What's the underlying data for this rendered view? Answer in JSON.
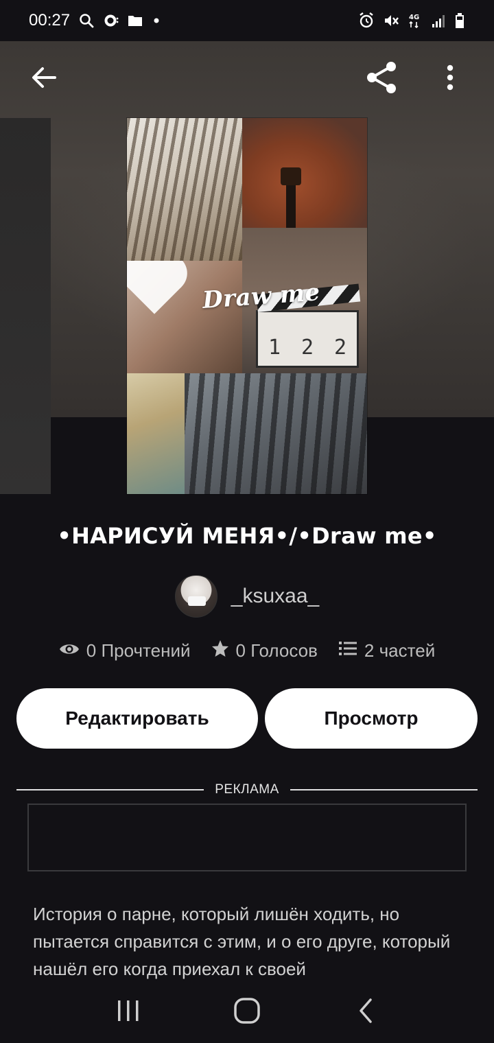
{
  "status_bar": {
    "time": "00:27",
    "network_label": "4G"
  },
  "cover": {
    "overlay_title": "Draw me",
    "clapper_cells": [
      "1",
      "2",
      "2"
    ]
  },
  "story": {
    "title": "•НАРИСУЙ МЕНЯ•/•Draw me•",
    "author": "_ksuxaa_",
    "stats": {
      "reads": "0 Прочтений",
      "votes": "0 Голосов",
      "parts": "2 частей"
    },
    "description": "История о парне, который лишён ходить, но пытается справится с этим, и о его друге, который нашёл его когда приехал к своей"
  },
  "actions": {
    "edit_label": "Редактировать",
    "view_label": "Просмотр"
  },
  "ad": {
    "label": "РЕКЛАМА"
  },
  "icons": {
    "back": "arrow-left-icon",
    "share": "share-icon",
    "more": "more-vertical-icon",
    "reads": "eye-icon",
    "votes": "star-icon",
    "parts": "list-icon"
  },
  "colors": {
    "background": "#121115",
    "button_bg": "#ffffff",
    "button_text": "#121115",
    "text_primary": "#ffffff",
    "text_secondary": "#bdbdbd"
  }
}
